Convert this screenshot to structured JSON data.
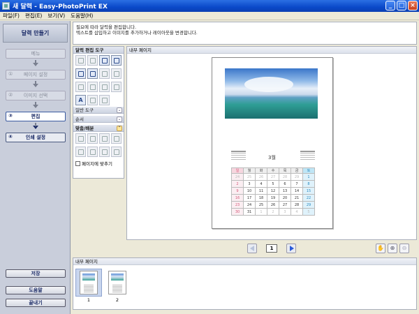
{
  "window": {
    "title": "새 달력 - Easy-PhotoPrint EX"
  },
  "menu": [
    "파일(F)",
    "편집(E)",
    "보기(V)",
    "도움말(H)"
  ],
  "sidebar": {
    "title": "달력 만들기",
    "menu_label": "메뉴",
    "steps": [
      {
        "num": "①",
        "label": "페이지 설정"
      },
      {
        "num": "②",
        "label": "이미지 선택"
      },
      {
        "num": "③",
        "label": "편집"
      },
      {
        "num": "④",
        "label": "인쇄 설정"
      }
    ],
    "save": "저장",
    "help": "도움말",
    "exit": "끝내기"
  },
  "instructions": {
    "line1": "필요에 따라 달력을 편집합니다.",
    "line2": "텍스트를 삽입하고 이미지를 추가하거나 레이아웃을 변경합니다."
  },
  "tools": {
    "header": "달력 편집 도구",
    "general": "일반 도구",
    "order": "순서",
    "align": "맞춤/배분",
    "fit_page": "페이지에 맞추기"
  },
  "canvas": {
    "header": "내부 페이지",
    "month": "3월"
  },
  "calendar": {
    "weekdays": [
      "일",
      "월",
      "화",
      "수",
      "목",
      "금",
      "토"
    ],
    "weeks": [
      [
        "24",
        "25",
        "26",
        "27",
        "28",
        "29",
        "1"
      ],
      [
        "2",
        "3",
        "4",
        "5",
        "6",
        "7",
        "8"
      ],
      [
        "9",
        "10",
        "11",
        "12",
        "13",
        "14",
        "15"
      ],
      [
        "16",
        "17",
        "18",
        "19",
        "20",
        "21",
        "22"
      ],
      [
        "23",
        "24",
        "25",
        "26",
        "27",
        "28",
        "29"
      ],
      [
        "30",
        "31",
        "1",
        "2",
        "3",
        "4",
        "5"
      ]
    ]
  },
  "nav": {
    "page": "1"
  },
  "thumbnails": {
    "header": "내부 페이지",
    "pages": [
      "1",
      "2"
    ]
  }
}
